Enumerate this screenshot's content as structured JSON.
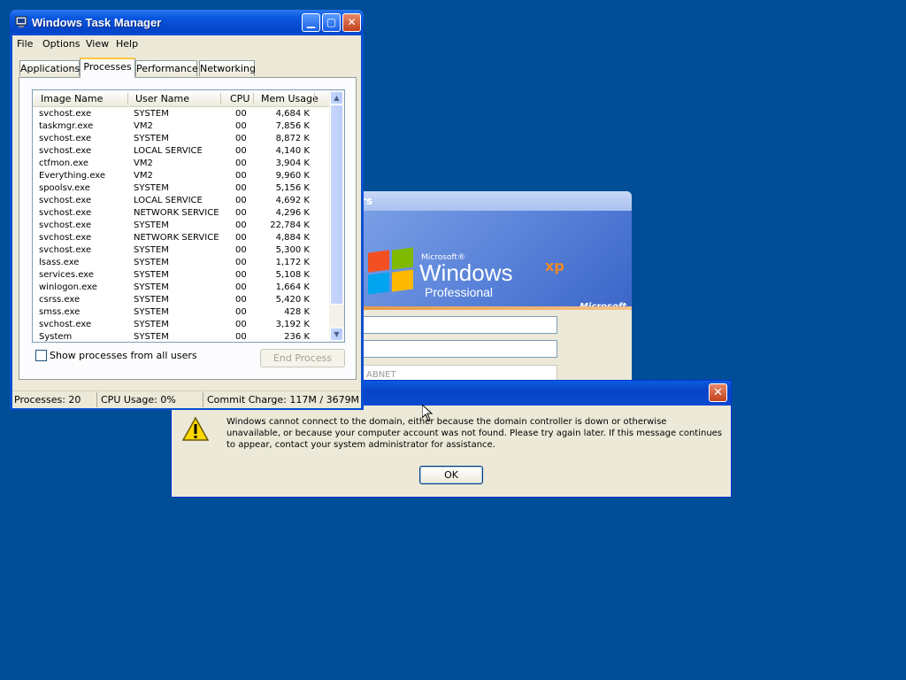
{
  "desktop": {
    "background": "#004e98"
  },
  "logon_window": {
    "title_fragment": "rs",
    "brand_small": "Microsoft®",
    "brand_windows": "Windows",
    "brand_xp": "xp",
    "brand_edition": "Professional",
    "brand_microsoft": "Microsoft",
    "domain_fragment": "ABNET"
  },
  "task_manager": {
    "title": "Windows Task Manager",
    "menu": [
      "File",
      "Options",
      "View",
      "Help"
    ],
    "tabs": [
      "Applications",
      "Processes",
      "Performance",
      "Networking"
    ],
    "active_tab": "Processes",
    "columns": [
      "Image Name",
      "User Name",
      "CPU",
      "Mem Usage"
    ],
    "processes": [
      {
        "image": "svchost.exe",
        "user": "SYSTEM",
        "cpu": "00",
        "mem": "4,684 K"
      },
      {
        "image": "taskmgr.exe",
        "user": "VM2",
        "cpu": "00",
        "mem": "7,856 K"
      },
      {
        "image": "svchost.exe",
        "user": "SYSTEM",
        "cpu": "00",
        "mem": "8,872 K"
      },
      {
        "image": "svchost.exe",
        "user": "LOCAL SERVICE",
        "cpu": "00",
        "mem": "4,140 K"
      },
      {
        "image": "ctfmon.exe",
        "user": "VM2",
        "cpu": "00",
        "mem": "3,904 K"
      },
      {
        "image": "Everything.exe",
        "user": "VM2",
        "cpu": "00",
        "mem": "9,960 K"
      },
      {
        "image": "spoolsv.exe",
        "user": "SYSTEM",
        "cpu": "00",
        "mem": "5,156 K"
      },
      {
        "image": "svchost.exe",
        "user": "LOCAL SERVICE",
        "cpu": "00",
        "mem": "4,692 K"
      },
      {
        "image": "svchost.exe",
        "user": "NETWORK SERVICE",
        "cpu": "00",
        "mem": "4,296 K"
      },
      {
        "image": "svchost.exe",
        "user": "SYSTEM",
        "cpu": "00",
        "mem": "22,784 K"
      },
      {
        "image": "svchost.exe",
        "user": "NETWORK SERVICE",
        "cpu": "00",
        "mem": "4,884 K"
      },
      {
        "image": "svchost.exe",
        "user": "SYSTEM",
        "cpu": "00",
        "mem": "5,300 K"
      },
      {
        "image": "lsass.exe",
        "user": "SYSTEM",
        "cpu": "00",
        "mem": "1,172 K"
      },
      {
        "image": "services.exe",
        "user": "SYSTEM",
        "cpu": "00",
        "mem": "5,108 K"
      },
      {
        "image": "winlogon.exe",
        "user": "SYSTEM",
        "cpu": "00",
        "mem": "1,664 K"
      },
      {
        "image": "csrss.exe",
        "user": "SYSTEM",
        "cpu": "00",
        "mem": "5,420 K"
      },
      {
        "image": "smss.exe",
        "user": "SYSTEM",
        "cpu": "00",
        "mem": "428 K"
      },
      {
        "image": "svchost.exe",
        "user": "SYSTEM",
        "cpu": "00",
        "mem": "3,192 K"
      },
      {
        "image": "System",
        "user": "SYSTEM",
        "cpu": "00",
        "mem": "236 K"
      }
    ],
    "show_all_label": "Show processes from all users",
    "show_all_checked": false,
    "end_process_label": "End Process",
    "status": {
      "processes": "Processes: 20",
      "cpu": "CPU Usage: 0%",
      "commit": "Commit Charge: 117M / 3679M"
    }
  },
  "error_dialog": {
    "message": "Windows cannot connect to the domain, either because the domain controller is down or otherwise unavailable, or because your computer account was not found. Please try again later. If this message continues to appear, contact your system administrator for assistance.",
    "ok_label": "OK"
  }
}
